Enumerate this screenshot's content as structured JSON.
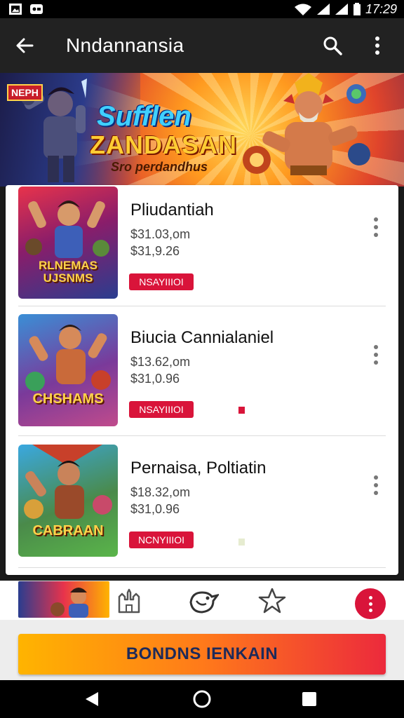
{
  "status_bar": {
    "time": "17:29",
    "icons": [
      "image-icon",
      "gamepad-icon",
      "wifi-icon",
      "signal-icon",
      "signal-icon",
      "battery-icon"
    ]
  },
  "app_bar": {
    "title": "Nndannansia",
    "back_icon": "arrow-left-icon",
    "search_icon": "search-icon",
    "menu_icon": "more-vertical-icon"
  },
  "banner": {
    "tag": "NEPH",
    "headline": "Sufflen",
    "headline2": "ZANDASAN",
    "subtitle": "Sro perdandhus"
  },
  "list": {
    "items": [
      {
        "name": "Pliudantiah",
        "price1": "$31.03,om",
        "price2": "$31,9.26",
        "badge": "NSAYIIIOI",
        "thumb_text": "RLNEMAS UJSNMS",
        "thumb_colors": [
          "#e8334b",
          "#2a3d8f",
          "#f5b33a"
        ]
      },
      {
        "name": "Biucia Cannialaniel",
        "price1": "$13.62,om",
        "price2": "$31,0.96",
        "badge": "NSAYIIIOI",
        "thumb_text": "CHSHAMS",
        "thumb_colors": [
          "#3a8fd6",
          "#c04b8c",
          "#f7c531"
        ]
      },
      {
        "name": "Pernaisa, Poltiatin",
        "price1": "$18.32,om",
        "price2": "$31,0.96",
        "badge": "NCNYIIIOI",
        "thumb_text": "CABRAAN",
        "thumb_colors": [
          "#3aa8e0",
          "#5ab54a",
          "#f0b830"
        ]
      }
    ]
  },
  "bottom_nav": {
    "items": [
      "castle-icon",
      "bird-icon",
      "star-icon"
    ],
    "fab_icon": "more-vertical-icon"
  },
  "cta": {
    "label": "BONDNS IENKAIN"
  },
  "system_nav": {
    "icons": [
      "back-triangle-icon",
      "home-circle-icon",
      "recents-square-icon"
    ]
  },
  "colors": {
    "accent_red": "#d9143a",
    "app_bar": "#222222",
    "cta_start": "#ffb400",
    "cta_end": "#ec2a3c"
  }
}
